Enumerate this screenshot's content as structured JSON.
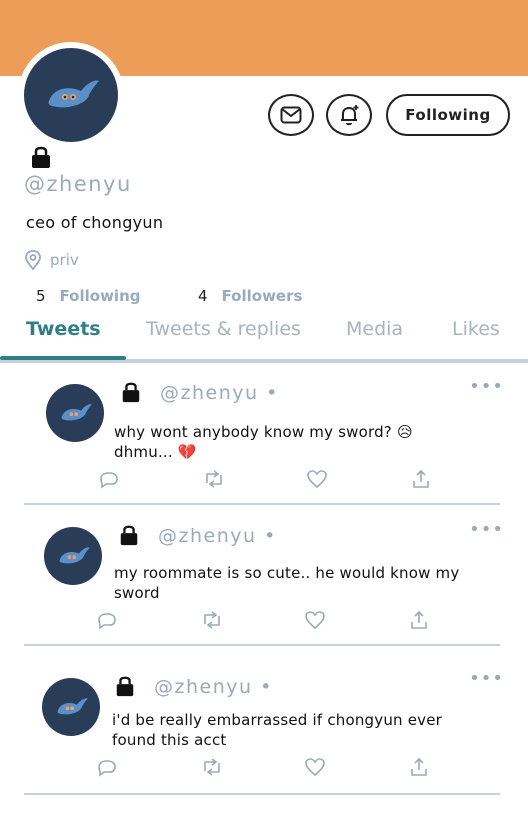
{
  "profile": {
    "handle": "@zhenyu",
    "bio": "ceo of chongyun",
    "location": "priv",
    "following_count": "5",
    "following_label": "Following",
    "followers_count": "4",
    "followers_label": "Followers",
    "follow_button_label": "Following"
  },
  "tabs": [
    "Tweets",
    "Tweets & replies",
    "Media",
    "Likes"
  ],
  "tweets": [
    {
      "handle": "@zhenyu •",
      "text": "why wont anybody know my sword? 😥 dhmu... 💔"
    },
    {
      "handle": "@zhenyu •",
      "text": "my roommate is so cute.. he would know my sword"
    },
    {
      "handle": "@zhenyu •",
      "text": "i'd be really embarrassed if chongyun ever found this acct"
    }
  ],
  "colors": {
    "banner": "#ec9d58",
    "avatar_bg": "#2a3d58",
    "accent": "#2e7f8a",
    "muted": "#9aaabb"
  }
}
